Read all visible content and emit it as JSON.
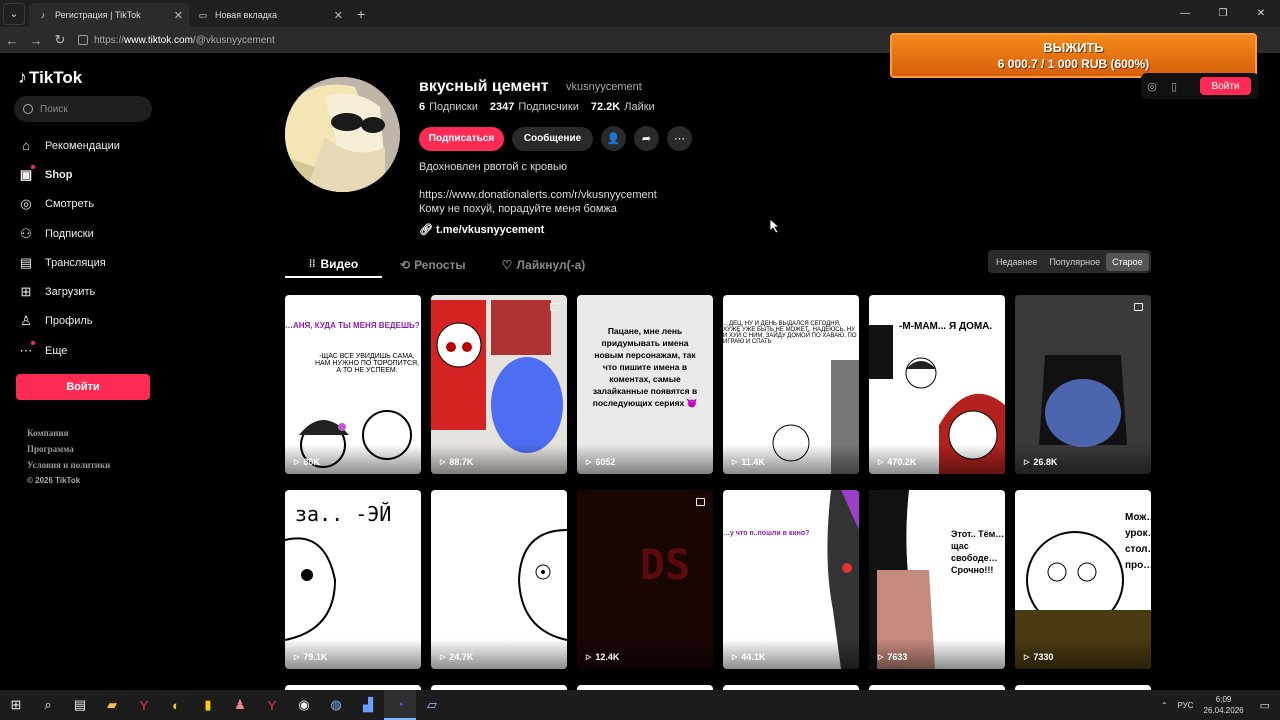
{
  "browser": {
    "tabs": [
      {
        "title": "Регистрация | TikTok",
        "active": true
      },
      {
        "title": "Новая вкладка",
        "active": false
      }
    ],
    "url_prefix": "https://",
    "url_host": "www.tiktok.com",
    "url_path": "/@vkusnyycement"
  },
  "overlay": {
    "line1": "ВЫЖИТЬ",
    "line2": "6 000.7 / 1 000 RUB (600%)"
  },
  "header": {
    "login_label": "Войти"
  },
  "sidebar": {
    "logo": "TikTok",
    "search_placeholder": "Поиск",
    "items": [
      {
        "label": "Рекомендации",
        "icon": "home-icon"
      },
      {
        "label": "Shop",
        "icon": "shop-icon"
      },
      {
        "label": "Смотреть",
        "icon": "compass-icon"
      },
      {
        "label": "Подписки",
        "icon": "user-plus-icon"
      },
      {
        "label": "Трансляция",
        "icon": "live-icon"
      },
      {
        "label": "Загрузить",
        "icon": "upload-icon"
      },
      {
        "label": "Профиль",
        "icon": "profile-icon"
      },
      {
        "label": "Еще",
        "icon": "more-icon"
      }
    ],
    "login_button": "Войти",
    "footer": [
      "Компания",
      "Программа",
      "Условия и политики"
    ],
    "copyright": "© 2026 TikTok"
  },
  "profile": {
    "name": "вкусный цемент",
    "username": "vkusnyycement",
    "following_count": "6",
    "following_label": "Подписки",
    "followers_count": "2347",
    "followers_label": "Подписчики",
    "likes_count": "72.2K",
    "likes_label": "Лайки",
    "subscribe_button": "Подписаться",
    "message_button": "Сообщение",
    "bio_line1": "Вдохновлен рвотой с кровью",
    "bio_line2": "https://www.donationalerts.com/r/vkusnyycement",
    "bio_line3": "Кому не похуй, порадуйте меня бомжа",
    "link": "t.me/vkusnyycement"
  },
  "content_tabs": [
    "Видео",
    "Репосты",
    "Лайкнул(-а)"
  ],
  "sort_options": [
    "Недавнее",
    "Популярное",
    "Старое"
  ],
  "sort_selected": "Старое",
  "videos": [
    {
      "views": "80K",
      "caption": "…АНЯ, КУДА ТЫ МЕНЯ ВЕДЕШЬ?",
      "caption2": "-ЩАС ВСЕ УВИДИШЬ САМА, НАМ НУЖНО ПО ТОРОПИТСЯ, А ТО НЕ УСПЕЕМ."
    },
    {
      "views": "88.7K",
      "caption": "",
      "caption2": ""
    },
    {
      "views": "6052",
      "caption": "Пацане, мне лень придумывать имена новым персонажам, так что пишите имена в коментах, самые залайканные появятся в последующих сериях 😈",
      "caption2": ""
    },
    {
      "views": "11.4K",
      "caption": "…ДЕЦ, НУ И ДЕНЬ ВЫДАЛСЯ СЕГОДНЯ, ХУЖЕ УЖЕ БЫТЬ НЕ МОЖЕТ.. НАДЕЮСЬ, НУ И ХУЙ С НИМ, ЗАЙДУ ДОМОЙ ПО ХАВАЮ, ПО ИГРАЮ И СПАТЬ",
      "caption2": ""
    },
    {
      "views": "470.2K",
      "caption": "-М-МАМ... Я ДОМА.",
      "caption2": ""
    },
    {
      "views": "26.8K",
      "caption": "",
      "caption2": ""
    },
    {
      "views": "79.1K",
      "caption": "за..   -ЭЙ",
      "caption2": ""
    },
    {
      "views": "24.7K",
      "caption": "",
      "caption2": ""
    },
    {
      "views": "12.4K",
      "caption": "DS",
      "caption2": ""
    },
    {
      "views": "44.1K",
      "caption": "…у что п..пошли в кино?",
      "caption2": ""
    },
    {
      "views": "7633",
      "caption": "Этот.. Тём… щас свободе… Срочно!!!",
      "caption2": ""
    },
    {
      "views": "7330",
      "caption": "Мож… урок… стол… про…",
      "caption2": ""
    }
  ],
  "taskbar": {
    "lang": "РУС",
    "time": "6:09",
    "date": "26.04.2026"
  },
  "colors": {
    "accent": "#fe2c55",
    "overlay": "#e8730f"
  }
}
